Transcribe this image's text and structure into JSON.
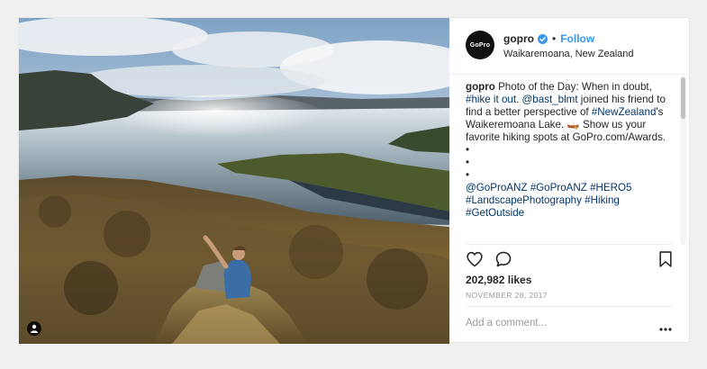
{
  "post": {
    "username": "gopro",
    "avatar_text": "GoPro",
    "separator": "•",
    "follow_label": "Follow",
    "location": "Waikaremoana, New Zealand",
    "caption": {
      "username": "gopro",
      "text1": " Photo of the Day: When in doubt, ",
      "tag_hikeitout": "#hike it out",
      "text2": ". ",
      "mention": "@bast_blmt",
      "text3": " joined his friend to find a better perspective of ",
      "tag_nz": "#NewZealand",
      "text4": "'s Waikeremoana Lake. 🛶 Show us your favorite hiking spots at GoPro.com/Awards.",
      "bullets": [
        "•",
        "•",
        "•"
      ],
      "mention2": "@GoProANZ",
      "tags": [
        "#GoProANZ",
        "#HERO5",
        "#LandscapePhotography",
        "#Hiking",
        "#GetOutside"
      ]
    },
    "likes": "202,982 likes",
    "date": "NOVEMBER 28, 2017",
    "comment_placeholder": "Add a comment..."
  },
  "icons": {
    "verified": "verified-badge-icon",
    "like": "heart-icon",
    "comment": "comment-bubble-icon",
    "save": "bookmark-icon",
    "more": "ellipsis-icon",
    "tag": "user-tag-icon"
  },
  "colors": {
    "link": "#003569",
    "follow": "#3897f0",
    "muted": "#999999"
  }
}
